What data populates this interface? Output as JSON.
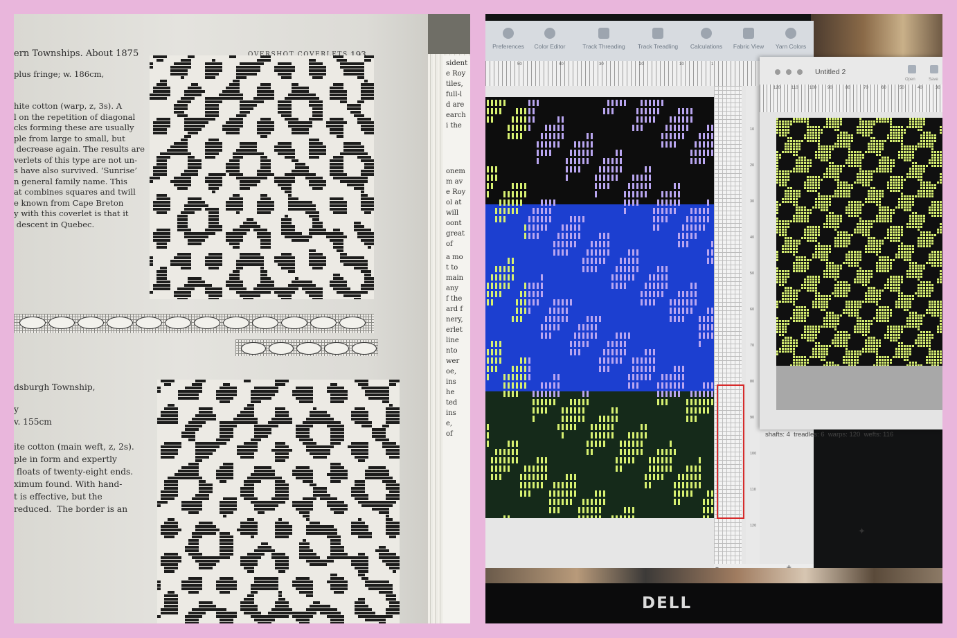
{
  "book": {
    "header_left": "ern Townships. About 1875",
    "running_head": "OVERSHOT COVERLETS",
    "page_number": "193",
    "para1": [
      "plus fringe; w. 186cm,"
    ],
    "para2": [
      "hite cotton (warp, z, 3s). A",
      "l on the repetition of diagonal",
      "cks forming these are usually",
      "ple from large to small, but",
      " decrease again. The results are",
      "verlets of this type are not un-",
      "s have also survived. ‘Sunrise’",
      "n general family name. This",
      "at combines squares and twill",
      "e known from Cape Breton",
      "y with this coverlet is that it",
      " descent in Quebec."
    ],
    "para3": [
      "dsburgh Township,"
    ],
    "para4": [
      "y",
      "v. 155cm"
    ],
    "para5": [
      "ite cotton (main weft, z, 2s).",
      "ple in form and expertly",
      " floats of twenty-eight ends.",
      "ximum found. With hand-",
      "t is effective, but the",
      "reduced.  The border is an"
    ],
    "edge_lines_a": [
      "sident",
      "",
      "",
      "",
      "e Roy",
      "tiles,",
      "full-l",
      "d are",
      "earch",
      "i the"
    ],
    "edge_lines_b": [
      "onem",
      "m av",
      "e Roy",
      "ol at",
      "will",
      "oont",
      "great",
      "of"
    ],
    "edge_lines_c": [
      "a mo",
      "t to",
      "main",
      "any",
      "f the",
      "ard f",
      "nery,",
      "erlet"
    ],
    "edge_lines_d": [
      "line",
      "nto",
      "wer",
      "oe,",
      "ins",
      "he",
      "ted",
      "ins",
      "e,",
      "of"
    ]
  },
  "app": {
    "toolbar": [
      {
        "label": "Preferences",
        "icon": "gear-icon"
      },
      {
        "label": "Color Editor",
        "icon": "color-editor-icon"
      },
      {
        "label": "Track Threading",
        "icon": "track-threading-icon"
      },
      {
        "label": "Track Treadling",
        "icon": "track-treadling-icon"
      },
      {
        "label": "Calculations",
        "icon": "calculations-icon"
      },
      {
        "label": "Fabric View",
        "icon": "fabric-view-icon"
      },
      {
        "label": "Yarn Colors",
        "icon": "yarn-colors-icon"
      }
    ],
    "ruler_numbers": [
      "50",
      "40",
      "30",
      "20",
      "10",
      "1"
    ],
    "side_ruler_numbers": [
      "10",
      "20",
      "30",
      "40",
      "50",
      "60",
      "70",
      "80",
      "90",
      "100",
      "110",
      "120"
    ],
    "window2": {
      "title": "Untitled 2",
      "buttons": [
        "Open",
        "Save"
      ],
      "ruler_numbers": [
        "120",
        "110",
        "100",
        "90",
        "80",
        "70",
        "60",
        "50",
        "40",
        "30"
      ],
      "side_numbers": [
        "10",
        "20",
        "30",
        "40",
        "50",
        "60",
        "70"
      ],
      "status": "shafts: 4  treadles: 6  warps: 120  wefts: 116"
    },
    "plus_label": "+",
    "minus_label": "–",
    "sparkle": "✦"
  },
  "monitor": {
    "brand": "DELL"
  },
  "colors": {
    "background": "#e9b6dc",
    "draft_blue": "#1c3fd0",
    "thread_lilac": "#b9a6f0",
    "thread_yellow": "#d7f071",
    "selection_red": "#d62b2b"
  }
}
